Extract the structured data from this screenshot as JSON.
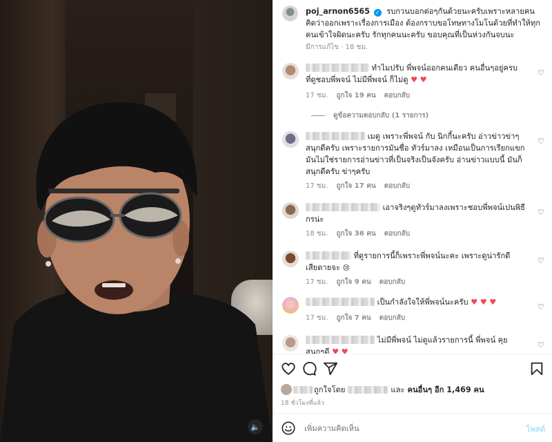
{
  "post": {
    "username": "poj_arnon6565",
    "verified_glyph": "✓",
    "caption": "รบกวนบอกต่อๆกันด้วยนะครับเพราะหลายคนคิดว่าออกเพราะเรื่องการเมือง ต้องกราบขอโทษทางโมโนด้วยที่ทำให้ทุกคนเข้าใจผิดนะครับ รักทุกคนนะครับ ขอบคุณที่เป็นห่วงกันจบนะ",
    "edited": "มีการแก้ไข",
    "edited_time": "18 ชม."
  },
  "comments": [
    {
      "text": "ทำไมปรับ พี่พจน์ออกคนเดียว คนอื่นๆอยู่ครบ ที่ดูชอบพี่พจน์ ไม่มีพี่พจน์ ก็ไม่ดู",
      "hearts": "♥ ♥",
      "time": "17 ชม.",
      "likes": "ถูกใจ 19 คน",
      "reply": "ตอบกลับ"
    },
    {
      "text": "เมดู เพราะพี่พจน์ กับ นิกกี้นะครับ อ่าวข่าวข่าๆ สนุกดีครับ เพราะรายการมันชื่อ ทัวร์มาลง เหมือนเป็นการเรียกแขก มันไม่ใช่รายการอ่านข่าวที่เป็นจริงเป็นจังครับ อ่านข่าวแบบนี้ มันก็สนุกดีครับ ข่าๆครับ",
      "time": "17 ชม.",
      "likes": "ถูกใจ 17 คน",
      "reply": "ตอบกลับ"
    },
    {
      "text": "เอาจริงๆดูทัวร์มาลงเพราะชอบพี่พจน์เปนพิธีกรน่ะ",
      "time": "18 ชม.",
      "likes": "ถูกใจ 36 คน",
      "reply": "ตอบกลับ"
    },
    {
      "text": "ที่ดูรายการนี้ก็เพราะพี่พจน์นะคะ เพราะดูน่ารักดี เสียดายจะ",
      "emoji": "😢",
      "time": "17 ชม.",
      "likes": "ถูกใจ 9 คน",
      "reply": "ตอบกลับ"
    },
    {
      "text": "เป็นกำลังใจให้พี่พจน์นะครับ",
      "hearts": "♥ ♥ ♥",
      "time": "17 ชม.",
      "likes": "ถูกใจ 7 คน",
      "reply": "ตอบกลับ"
    },
    {
      "text": "ไม่มีพี่พจน์ ไม่ดูแล้วรายการนี้ พี่พจน์ คุยสนุกๆดี",
      "hearts": "♥ ♥"
    }
  ],
  "view_replies": "ดูข้อความตอบกลับ (1 รายการ)",
  "liked_by": {
    "prefix": "ถูกใจโดย",
    "suffix_and": "และ",
    "suffix_others": "คนอื่นๆ อีก 1,469 คน"
  },
  "posted_ago": "18 ชั่วโมงที่แล้ว",
  "composer": {
    "placeholder": "เพิ่มความคิดเห็น",
    "post_label": "โพสต์"
  },
  "colors": {
    "accent": "#0095f6",
    "heart_red": "#ed4956",
    "muted": "#8e8e8e"
  },
  "icons": [
    "like-icon",
    "comment-icon",
    "share-icon",
    "save-icon",
    "emoji-icon",
    "volume-icon",
    "verified-icon"
  ]
}
